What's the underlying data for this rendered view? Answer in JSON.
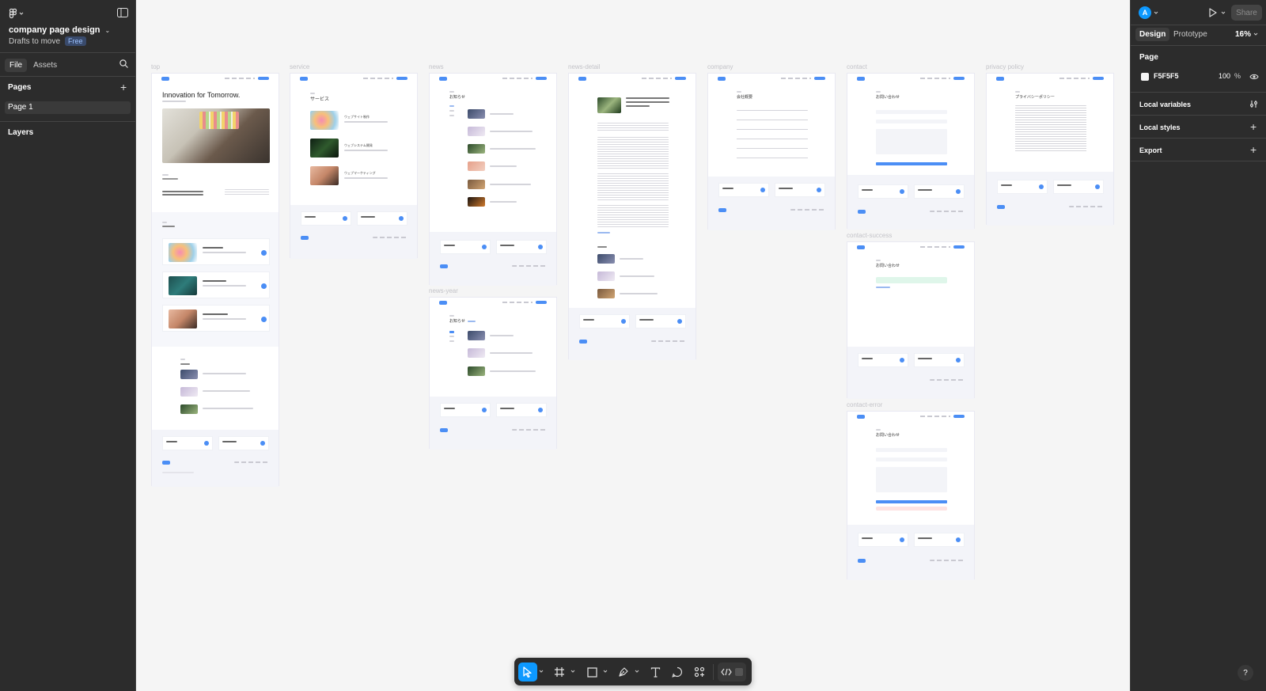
{
  "left_panel": {
    "file_name": "company page design",
    "location": "Drafts to move",
    "plan_badge": "Free",
    "tabs": {
      "file": "File",
      "assets": "Assets"
    },
    "pages_heading": "Pages",
    "pages": [
      "Page 1"
    ],
    "layers_heading": "Layers"
  },
  "right_panel": {
    "avatar_letter": "A",
    "share_label": "Share",
    "tabs": {
      "design": "Design",
      "prototype": "Prototype"
    },
    "zoom": "16%",
    "page_section": "Page",
    "bg_color_hex": "F5F5F5",
    "bg_opacity": "100",
    "percent_sign": "%",
    "local_variables": "Local variables",
    "local_styles": "Local styles",
    "export": "Export"
  },
  "frames": {
    "top": {
      "label": "top",
      "hero_title": "Innovation for Tomorrow."
    },
    "service": {
      "label": "service",
      "title": "サービス",
      "items": [
        "ウェブサイト制作",
        "ウェブシステム開発",
        "ウェブマーケティング"
      ]
    },
    "news": {
      "label": "news",
      "title": "お知らせ"
    },
    "news_year": {
      "label": "news-year",
      "title": "お知らせ"
    },
    "news_detail": {
      "label": "news-detail"
    },
    "company": {
      "label": "company",
      "title": "会社概要"
    },
    "contact": {
      "label": "contact",
      "title": "お問い合わせ"
    },
    "contact_success": {
      "label": "contact-success",
      "title": "お問い合わせ"
    },
    "contact_error": {
      "label": "contact-error",
      "title": "お問い合わせ"
    },
    "privacy": {
      "label": "privacy policy",
      "title": "プライバシーポリシー"
    }
  },
  "colors": {
    "accent": "#0d99ff",
    "panel": "#2c2c2c",
    "canvas": "#f5f5f5",
    "site_blue": "#4b8ef5"
  }
}
